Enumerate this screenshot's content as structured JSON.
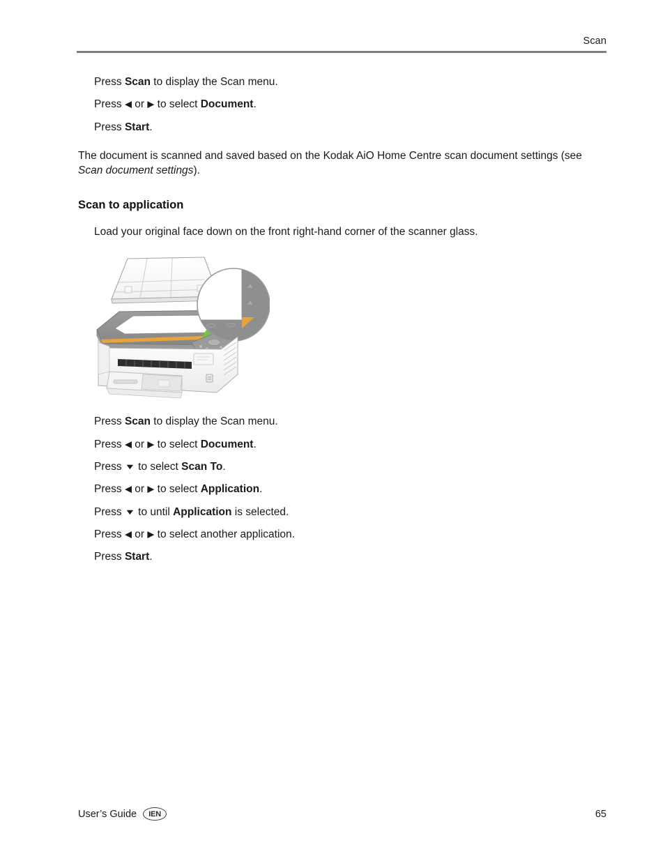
{
  "header": {
    "title": "Scan"
  },
  "intro_steps": [
    {
      "pre": "Press ",
      "bold1": "Scan",
      "mid": " to display the Scan menu.",
      "glyphs": "none"
    },
    {
      "pre": "Press ",
      "glyph_left": "◀",
      "or": " or ",
      "glyph_right": "▶",
      "mid": " to select ",
      "bold1": "Document",
      "post": ".",
      "glyphs": "lr"
    },
    {
      "pre": "Press ",
      "bold1": "Start",
      "mid": ".",
      "glyphs": "none"
    }
  ],
  "intro_paragraph": {
    "text_before": "The document is scanned and saved based on the Kodak AiO Home Centre scan document settings (see ",
    "italic": "Scan document settings",
    "text_after": ")."
  },
  "section": {
    "heading": "Scan to application",
    "load_instruction": "Load your original face down on the front right-hand corner of the scanner glass."
  },
  "figure": {
    "alt": "Kodak all-in-one printer with scanner lid open and magnified view of the front right-hand corner of the scanner glass",
    "colors": {
      "green_callout": "#7AC143",
      "orange_marker": "#E8A33D",
      "orange_strip": "#E8A33D",
      "body_gray": "#8C8C8C",
      "lid_white": "#FDFDFD",
      "outline": "#9A9A9A",
      "dark_slot": "#2E2E2E"
    }
  },
  "steps": [
    {
      "pre": "Press ",
      "bold1": "Scan",
      "mid": " to display the Scan menu.",
      "glyphs": "none"
    },
    {
      "pre": "Press ",
      "glyph_left": "◀",
      "or": " or ",
      "glyph_right": "▶",
      "mid": " to select ",
      "bold1": "Document",
      "post": ".",
      "glyphs": "lr"
    },
    {
      "pre": "Press ",
      "glyph_down": "▼",
      "mid": " to select ",
      "bold1": "Scan To",
      "post": ".",
      "glyphs": "down"
    },
    {
      "pre": "Press ",
      "glyph_left": "◀",
      "or": " or ",
      "glyph_right": "▶",
      "mid": " to select ",
      "bold1": "Application",
      "post": ".",
      "glyphs": "lr"
    },
    {
      "pre": "Press ",
      "glyph_down": "▼",
      "mid": " to until ",
      "bold1": "Application",
      "post": " is selected.",
      "glyphs": "down"
    },
    {
      "pre": "Press ",
      "glyph_left": "◀",
      "or": " or ",
      "glyph_right": "▶",
      "mid": " to select another application.",
      "glyphs": "lr"
    },
    {
      "pre": "Press ",
      "bold1": "Start",
      "mid": ".",
      "glyphs": "none"
    }
  ],
  "footer": {
    "guide_label": "User’s Guide",
    "badge_text": "IEN",
    "page_number": "65"
  }
}
